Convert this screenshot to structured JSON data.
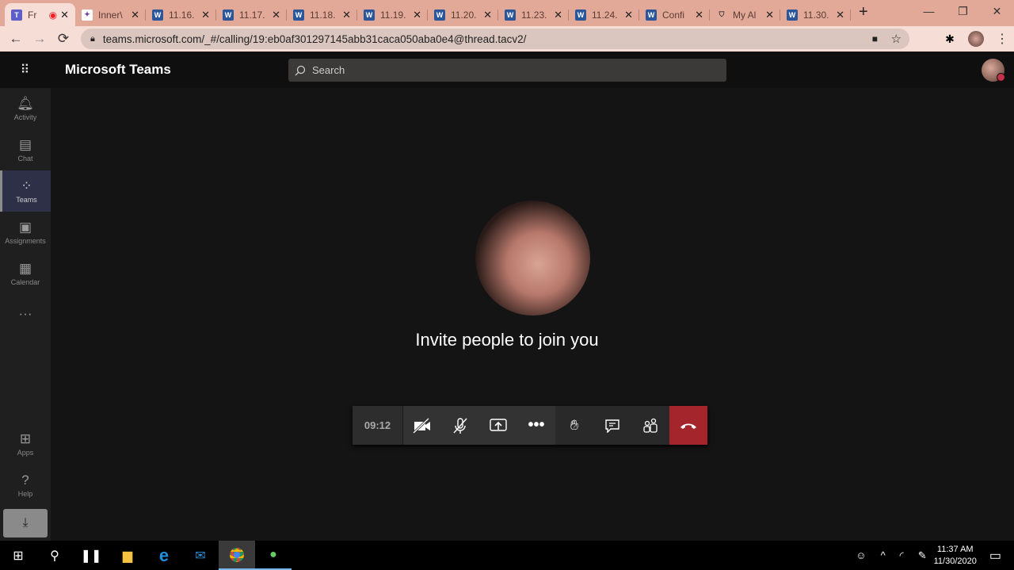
{
  "browser": {
    "tabs": [
      {
        "title": "Fr",
        "icon": "teams-icon",
        "active": true,
        "recording": true
      },
      {
        "title": "Inner\\",
        "icon": "innerview-icon"
      },
      {
        "title": "11.16.",
        "icon": "word-icon"
      },
      {
        "title": "11.17.",
        "icon": "word-icon"
      },
      {
        "title": "11.18.",
        "icon": "word-icon"
      },
      {
        "title": "11.19.",
        "icon": "word-icon"
      },
      {
        "title": "11.20.",
        "icon": "word-icon"
      },
      {
        "title": "11.23.",
        "icon": "word-icon"
      },
      {
        "title": "11.24.",
        "icon": "word-icon"
      },
      {
        "title": "Confi",
        "icon": "word-icon"
      },
      {
        "title": "My Al",
        "icon": "acorn-icon"
      },
      {
        "title": "11.30.",
        "icon": "word-icon"
      }
    ],
    "url": "teams.microsoft.com/_#/calling/19:eb0af301297145abb31caca050aba0e4@thread.tacv2/"
  },
  "teams": {
    "app_name": "Microsoft Teams",
    "search_placeholder": "Search",
    "rail": [
      {
        "label": "Activity",
        "icon": "bell-icon"
      },
      {
        "label": "Chat",
        "icon": "chat-icon"
      },
      {
        "label": "Teams",
        "icon": "teams-icon",
        "active": true
      },
      {
        "label": "Assignments",
        "icon": "backpack-icon"
      },
      {
        "label": "Calendar",
        "icon": "calendar-icon"
      }
    ],
    "rail_bottom": [
      {
        "label": "Apps",
        "icon": "apps-icon"
      },
      {
        "label": "Help",
        "icon": "help-icon"
      }
    ]
  },
  "call": {
    "message": "Invite people to join you",
    "timer": "09:12",
    "accent": "#a4262c"
  },
  "taskbar": {
    "time": "11:37 AM",
    "date": "11/30/2020"
  }
}
